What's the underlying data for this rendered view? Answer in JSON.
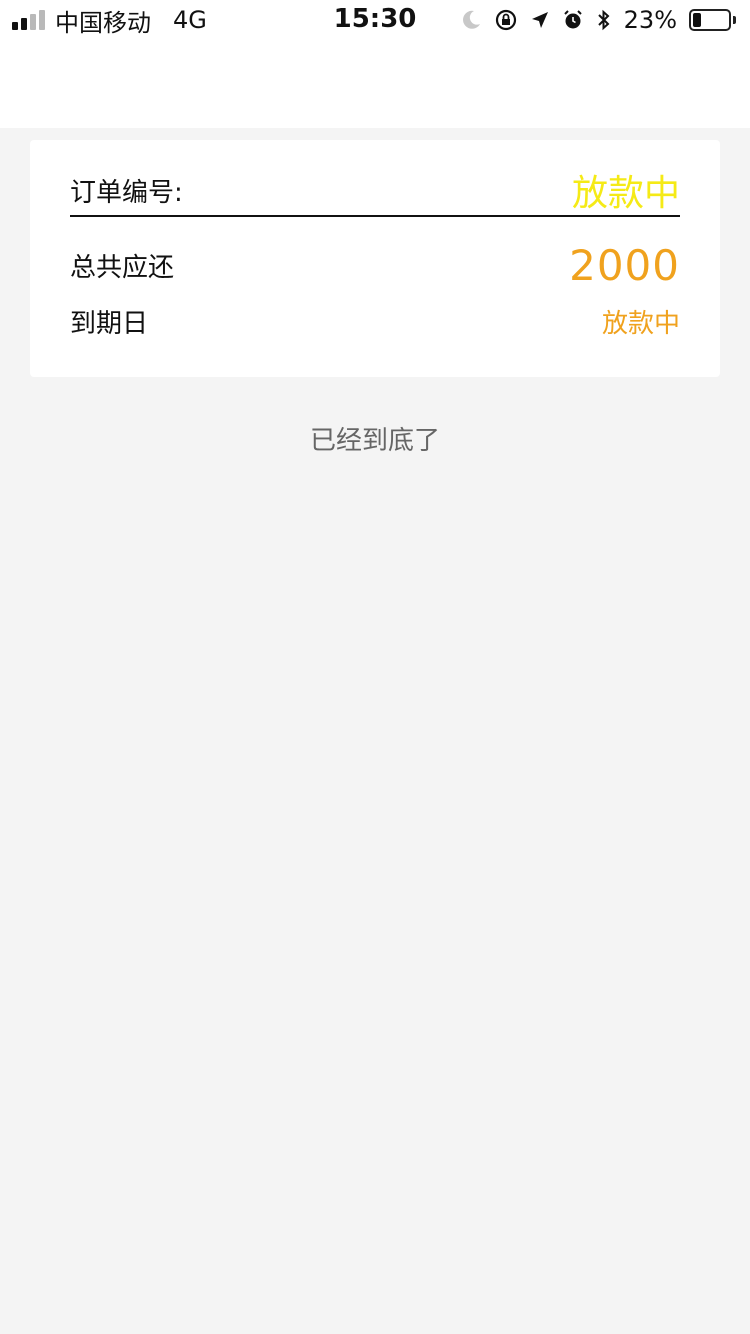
{
  "status_bar": {
    "carrier": "中国移动",
    "network": "4G",
    "time": "15:30",
    "battery": "23%",
    "battery_level": 0.23,
    "icons": [
      "signal-icon",
      "moon-icon",
      "orientation-lock-icon",
      "location-icon",
      "alarm-icon",
      "bluetooth-icon",
      "battery-icon"
    ]
  },
  "order_card": {
    "order_label": "订单编号:",
    "order_status": "放款中",
    "total_label": "总共应还",
    "total_amount": "2000",
    "due_label": "到期日",
    "due_value": "放款中"
  },
  "list_end": "已经到底了",
  "colors": {
    "status_yellow": "#f5ea16",
    "amount_orange": "#f0a21e",
    "background": "#f4f4f4",
    "card": "#ffffff"
  }
}
